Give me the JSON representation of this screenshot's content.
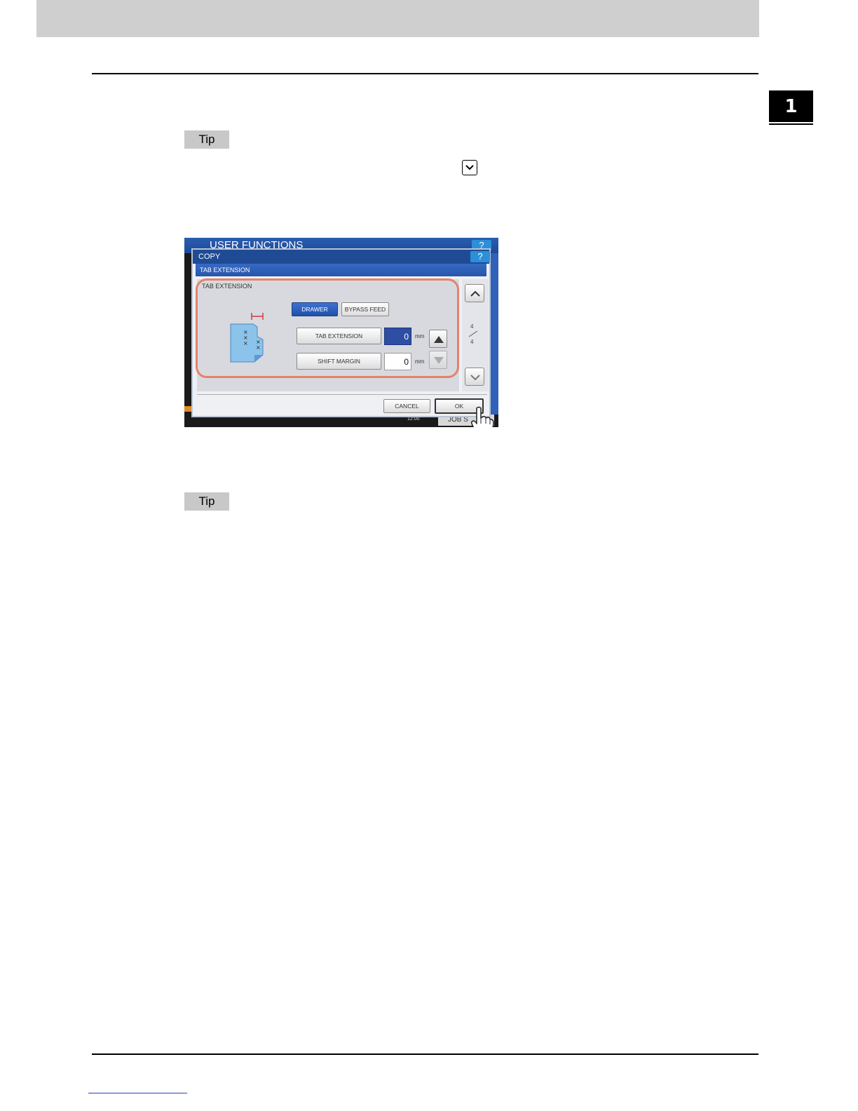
{
  "page": {
    "chapter_number": "1",
    "tip_label_1": "Tip",
    "tip_label_2": "Tip"
  },
  "screen": {
    "background_title": "USER FUNCTIONS",
    "background_help": "?",
    "clock": "12:00",
    "job_status": "JOB S",
    "dialog": {
      "title": "COPY",
      "help": "?",
      "subtitle": "TAB EXTENSION",
      "group_label": "TAB EXTENSION",
      "drawer_label": "DRAWER",
      "bypass_label": "BYPASS FEED",
      "tab_extension_label": "TAB EXTENSION",
      "tab_extension_value": "0",
      "shift_margin_label": "SHIFT MARGIN",
      "shift_margin_value": "0",
      "unit": "mm",
      "page_current": "4",
      "page_total": "4",
      "cancel_label": "CANCEL",
      "ok_label": "OK"
    }
  },
  "colors": {
    "highlight": "#e6826a",
    "accent_blue": "#1f4b95",
    "selected_button": "#2e4ea3"
  },
  "icons": [
    "chevron-down-icon",
    "up-arrow-icon",
    "down-arrow-icon",
    "chevron-up-icon",
    "hand-pointer-icon",
    "tab-paper-icon"
  ]
}
